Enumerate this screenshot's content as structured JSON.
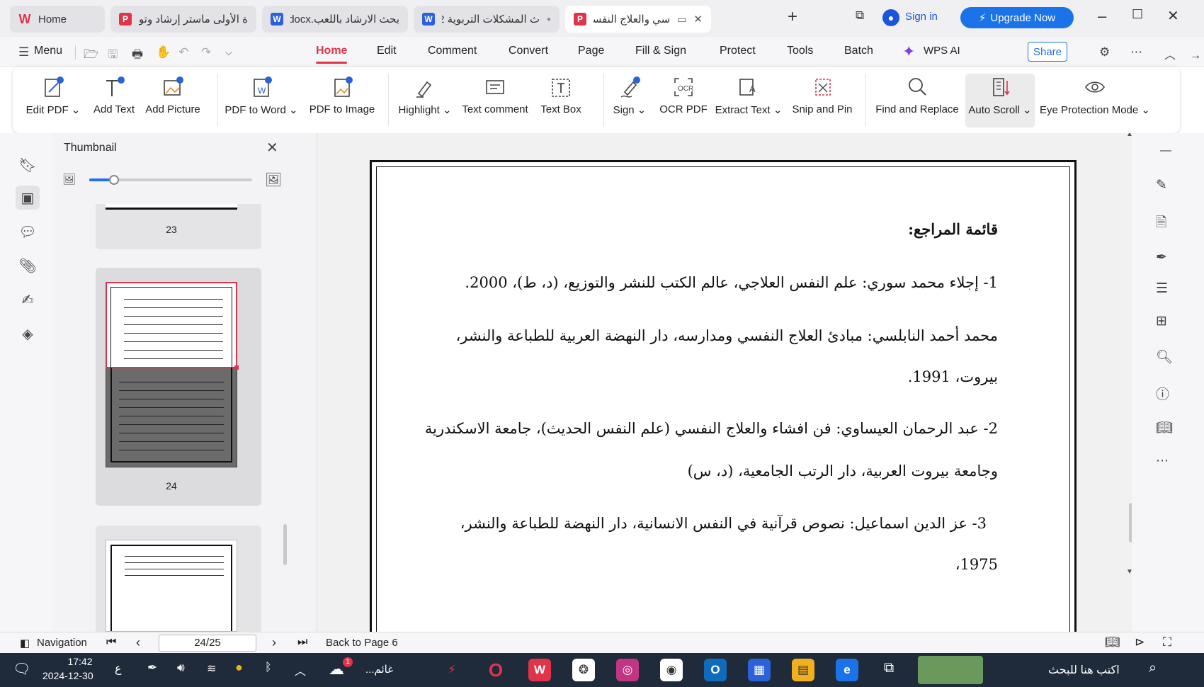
{
  "tabs": [
    {
      "label": "Home",
      "type": "wps",
      "active": false
    },
    {
      "label": "ة الأولى ماستر إرشاد وتوجيه",
      "type": "pdf",
      "active": false
    },
    {
      "label": "بحث الارشاد باللعب.docx",
      "type": "word",
      "active": false
    },
    {
      "label": "ث المشكلات التربوية 2",
      "type": "word",
      "active": false
    },
    {
      "label": "سي والعلاج النفسي",
      "type": "pdf",
      "active": true
    }
  ],
  "titlebar": {
    "sign_in": "Sign in",
    "upgrade": "Upgrade Now"
  },
  "menu": {
    "menu_label": "Menu",
    "items": [
      "Home",
      "Edit",
      "Comment",
      "Convert",
      "Page",
      "Fill & Sign",
      "Protect",
      "Tools",
      "Batch"
    ],
    "active": "Home",
    "wps_ai": "WPS AI",
    "share": "Share"
  },
  "ribbon": [
    {
      "label": "Edit PDF",
      "dropdown": true,
      "icon": "edit-pdf-icon"
    },
    {
      "label": "Add Text",
      "dropdown": false,
      "icon": "add-text-icon"
    },
    {
      "label": "Add Picture",
      "dropdown": false,
      "icon": "add-picture-icon"
    },
    {
      "label": "PDF to Word",
      "dropdown": true,
      "icon": "pdf-to-word-icon"
    },
    {
      "label": "PDF to Image",
      "dropdown": false,
      "icon": "pdf-to-image-icon"
    },
    {
      "label": "Highlight",
      "dropdown": true,
      "icon": "highlight-icon"
    },
    {
      "label": "Text comment",
      "dropdown": false,
      "icon": "text-comment-icon"
    },
    {
      "label": "Text Box",
      "dropdown": false,
      "icon": "text-box-icon"
    },
    {
      "label": "Sign",
      "dropdown": true,
      "icon": "sign-icon"
    },
    {
      "label": "OCR PDF",
      "dropdown": false,
      "icon": "ocr-icon"
    },
    {
      "label": "Extract Text",
      "dropdown": true,
      "icon": "extract-text-icon"
    },
    {
      "label": "Snip and Pin",
      "dropdown": false,
      "icon": "snip-icon"
    },
    {
      "label": "Find and Replace",
      "dropdown": false,
      "icon": "find-replace-icon"
    },
    {
      "label": "Auto Scroll",
      "dropdown": true,
      "icon": "auto-scroll-icon"
    },
    {
      "label": "Eye Protection Mode",
      "dropdown": true,
      "icon": "eye-icon"
    }
  ],
  "thumbnail": {
    "title": "Thumbnail",
    "zoom_level": 0.15,
    "pages": [
      {
        "number": "23"
      },
      {
        "number": "24"
      }
    ]
  },
  "document": {
    "heading": "قائمة المراجع:",
    "lines": [
      "1- إجلاء محمد سوري: علم النفس العلاجي، عالم الكتب للنشر والتوزيع، (د، ط)، 2000.",
      "محمد أحمد النابلسي: مبادئ العلاج النفسي ومدارسه، دار النهضة العربية للطباعة والنشر،",
      "بيروت، 1991.",
      "2- عبد الرحمان العيساوي: فن افشاء والعلاج النفسي (علم النفس الحديث)، جامعة الاسكندرية",
      "وجامعة بيروت العربية، دار الرتب الجامعية، (د، س)",
      "3- عز الدين اسماعيل: نصوص قرآنية في النفس الانسانية، دار النهضة للطباعة والنشر،",
      "1975،"
    ]
  },
  "status": {
    "navigation": "Navigation",
    "page_field": "24/25",
    "back_to_page": "Back to Page 6"
  },
  "taskbar": {
    "time": "17:42",
    "date": "2024-12-30",
    "lang": "ع",
    "weather": "غائم...",
    "search": "اكتب هنا للبحث",
    "notif_badge": "1"
  },
  "colors": {
    "accent": "#e0344a",
    "upgrade": "#1a73e8",
    "signin": "#1a56db"
  }
}
